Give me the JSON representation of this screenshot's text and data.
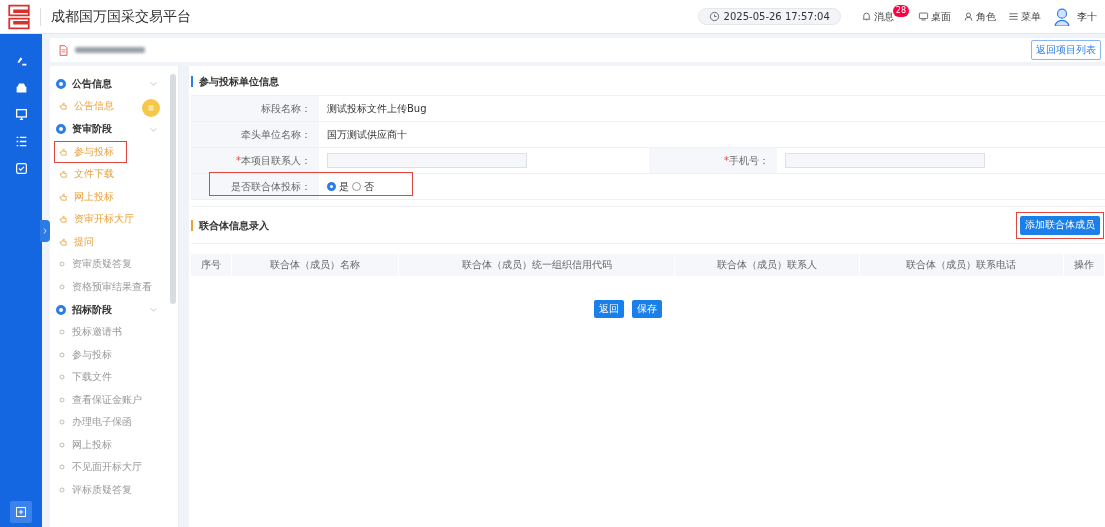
{
  "header": {
    "title": "成都国万国采交易平台",
    "datetime": "2025-05-26 17:57:04",
    "nav": [
      {
        "kind": "bell",
        "label": "消息",
        "badge": "28"
      },
      {
        "kind": "desktop",
        "label": "桌面"
      },
      {
        "kind": "user",
        "label": "角色"
      },
      {
        "kind": "menu",
        "label": "菜单"
      }
    ],
    "user": "李十"
  },
  "project_bar": {
    "back_button": "返回项目列表"
  },
  "steps": [
    {
      "title": "公告信息",
      "expanded": true,
      "children": [
        {
          "label": "公告信息",
          "done": true,
          "selected": false
        }
      ]
    },
    {
      "title": "资审阶段",
      "expanded": true,
      "children": [
        {
          "label": "参与投标",
          "done": true,
          "selected": true
        },
        {
          "label": "文件下载",
          "done": true,
          "selected": false
        },
        {
          "label": "网上投标",
          "done": true,
          "selected": false
        },
        {
          "label": "资审开标大厅",
          "done": true,
          "selected": false
        },
        {
          "label": "提问",
          "done": true,
          "selected": false
        },
        {
          "label": "资审质疑答复",
          "done": false,
          "selected": false
        },
        {
          "label": "资格预审结果查看",
          "done": false,
          "selected": false
        }
      ]
    },
    {
      "title": "招标阶段",
      "expanded": true,
      "children": [
        {
          "label": "投标邀请书",
          "done": false,
          "selected": false
        },
        {
          "label": "参与投标",
          "done": false,
          "selected": false
        },
        {
          "label": "下载文件",
          "done": false,
          "selected": false
        },
        {
          "label": "查看保证金账户",
          "done": false,
          "selected": false
        },
        {
          "label": "办理电子保函",
          "done": false,
          "selected": false
        },
        {
          "label": "网上投标",
          "done": false,
          "selected": false
        },
        {
          "label": "不见面开标大厅",
          "done": false,
          "selected": false
        },
        {
          "label": "评标质疑答复",
          "done": false,
          "selected": false
        }
      ]
    }
  ],
  "bidder_section": {
    "title": "参与投标单位信息",
    "rows": [
      {
        "kind": "text",
        "label": "标段名称：",
        "value": "测试投标文件上传Bug"
      },
      {
        "kind": "text",
        "label": "牵头单位名称：",
        "value": "国万测试供应商十"
      },
      {
        "kind": "inputs",
        "fields": [
          {
            "label": "本项目联系人：",
            "required_mark": "*"
          },
          {
            "label": "手机号：",
            "required_mark": "*"
          }
        ]
      },
      {
        "kind": "radio",
        "label": "是否联合体投标：",
        "highlighted": true,
        "options": [
          {
            "label": "是",
            "selected": true
          },
          {
            "label": "否",
            "selected": false
          }
        ]
      }
    ]
  },
  "consortium_section": {
    "title": "联合体信息录入",
    "add_button": {
      "label": "添加联合体成员",
      "highlighted": true
    },
    "table": {
      "columns": [
        "序号",
        "联合体（成员）名称",
        "联合体（成员）统一组织信用代码",
        "联合体（成员）联系人",
        "联合体（成员）联系电话",
        "操作"
      ]
    }
  },
  "actions": [
    "返回",
    "保存"
  ]
}
